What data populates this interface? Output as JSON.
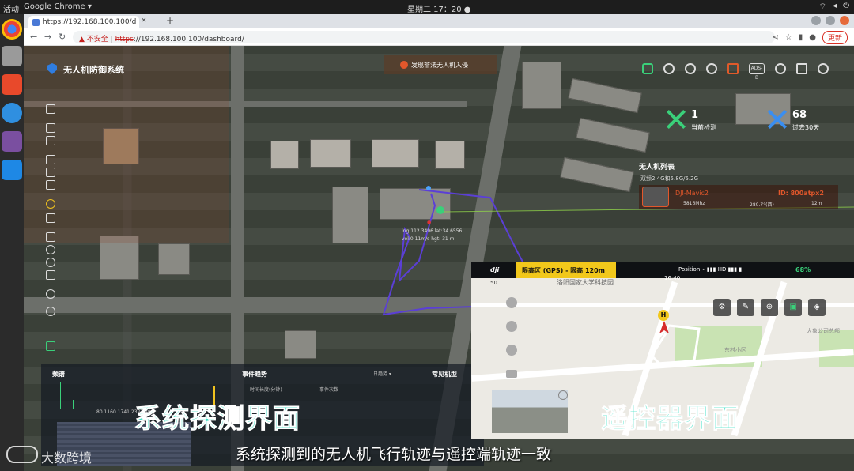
{
  "system_bar": {
    "activities": "活动",
    "app": "Google Chrome ▾",
    "clock": "星期二 17：20 ●"
  },
  "browser": {
    "tab_title": "https://192.168.100.100/d",
    "tab_close": "×",
    "new_tab": "+",
    "insecure_label": "不安全",
    "url_protocol": "https",
    "url_rest": "://192.168.100.100/dashboard/",
    "update_button": "更新"
  },
  "app": {
    "title": "无人机防御系统",
    "alert": "发现非法无人机入侵",
    "adsb_label": "ADS-B"
  },
  "stats": {
    "current": {
      "value": "1",
      "label": "当前检测"
    },
    "past30": {
      "value": "68",
      "label": "过去30天"
    }
  },
  "uav_list": {
    "title": "无人机列表",
    "subtitle": "双频2.4G和5.8G/5.2G",
    "item": {
      "name": "DJI-Mavic2",
      "id": "ID: 800atpx2",
      "freq": "5816Mhz",
      "direction": "280.7°(西)",
      "distance": "12m"
    }
  },
  "map_marker": {
    "line1": "lng:112.3496 lat:34.6556",
    "line2": "vel:0.11m/s hgt: 31 m"
  },
  "bottom_panel": {
    "spectrum_title": "频谱",
    "event_trend_title": "事件趋势",
    "legend_duration": "时间长度(分钟)",
    "legend_count": "事件次数",
    "period": "日趋势 ▾",
    "common_models": "常见机型",
    "bar_values": "80  1160  1741  2321  29"
  },
  "rc": {
    "logo": "dji",
    "flight_mode": "限高区 (GPS) - 限高 120m",
    "status": "Position  ⌁  ▮▮▮  HD ▮▮▮  ▮",
    "battery": "68%",
    "time": "16:40",
    "scale": "50",
    "campus": "洛阳国家大学科技园",
    "label_park": "东村小区",
    "label_company": "大象公司总部",
    "home_marker": "H"
  },
  "captions": {
    "left": "系统探测界面",
    "right": "遥控器界面",
    "subtitle": "系统探测到的无人机飞行轨迹与遥控端轨迹一致",
    "watermark": "大数跨境"
  },
  "colors": {
    "accent_green": "#3ad07a",
    "alert_orange": "#e2572b",
    "dji_yellow": "#f2c81b",
    "caption_teal": "#3ae0c4"
  }
}
